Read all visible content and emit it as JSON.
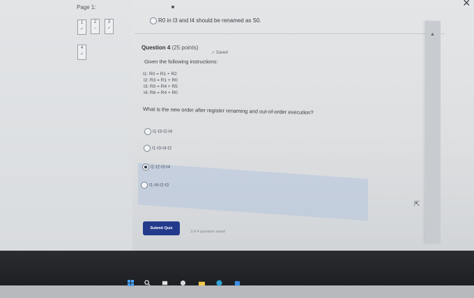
{
  "sidebar": {
    "page_label": "Page 1:",
    "questions": [
      {
        "num": "1",
        "mark": "✓"
      },
      {
        "num": "2",
        "mark": "–"
      },
      {
        "num": "3",
        "mark": "✓"
      },
      {
        "num": "4",
        "mark": "✓"
      }
    ]
  },
  "previous_option": "R0 in I3 and I4 should be renamed as S0.",
  "question": {
    "title": "Question 4",
    "points": "(25 points)",
    "saved": "✓ Saved",
    "intro": "Given the following instructions:",
    "instructions": [
      "I1: R0 = R1 + R2",
      "I2: R3 = R1 + R0",
      "I3: R0 = R4 + R5",
      "I4: R6 = R4 + R0"
    ],
    "text": "What is the new order after register renaming and out-of-order execution?",
    "options": [
      {
        "label": "I1-I3-I2-I4",
        "selected": false
      },
      {
        "label": "I1-I3-I4-I2",
        "selected": false
      },
      {
        "label": "I1-I2-I3-I4",
        "selected": true
      },
      {
        "label": "I1-I4-I2-I3",
        "selected": false
      }
    ]
  },
  "footer": {
    "submit_label": "Submit Quiz",
    "progress_text": "3 of 4 questions saved"
  },
  "icons": {
    "close": "close-icon",
    "cursor": "cursor-icon",
    "windows": "windows-icon",
    "search": "search-icon"
  },
  "colors": {
    "submit_bg": "#233a8c",
    "selected_highlight": "#b4c4dc",
    "taskbar": "#1b1c20"
  }
}
